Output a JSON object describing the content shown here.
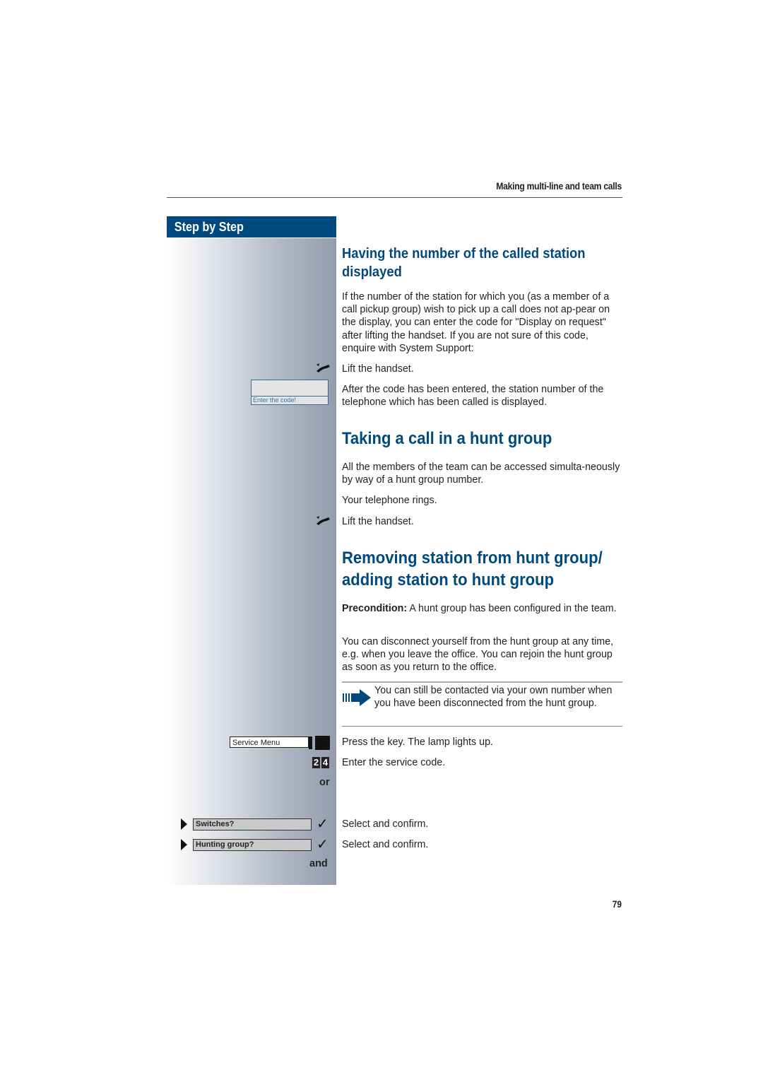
{
  "header": {
    "title": "Making multi-line and team calls"
  },
  "sidebar": {
    "heading": "Step by Step",
    "display": {
      "label": "Enter the code!"
    },
    "service_menu": {
      "label": "Service Menu"
    },
    "digits": [
      "2",
      "4"
    ],
    "or_label": "or",
    "menu_items": [
      {
        "label": "Switches?"
      },
      {
        "label": "Hunting group?"
      }
    ],
    "and_label": "and",
    "icons": {
      "handset": "handset-lift-icon",
      "check": "checkmark-icon",
      "arrow": "right-triangle-icon"
    }
  },
  "sections": {
    "display_number": {
      "title": "Having the number of the called station displayed",
      "intro": "If the number of the station for which you (as a member of a call pickup group) wish to pick up a call does not ap-pear on the display, you can enter the code for \"Display on request\" after lifting the handset. If you are not sure of this code, enquire with System Support:",
      "step1": "Lift the handset.",
      "step2": "After the code has been entered, the station number of the telephone which has been called is displayed."
    },
    "hunt_group_call": {
      "title": "Taking a call in a hunt group",
      "intro": "All the members of the team can be accessed simulta-neously by way of a hunt group number.",
      "step1": "Your telephone rings.",
      "step2": "Lift the handset."
    },
    "remove_add": {
      "title_line1": "Removing station from hunt group/",
      "title_line2": "adding station to hunt group",
      "precondition_label": "Precondition:",
      "precondition_text": " A hunt group has been configured in the team.",
      "body": "You can disconnect yourself from the hunt group at any time, e.g. when you leave the office. You can rejoin the hunt group as soon as you return to the office.",
      "note": "You can still be contacted via your own number when you have been disconnected from the hunt group.",
      "step_press": "Press the key. The lamp lights up.",
      "step_code": "Enter the service code.",
      "step_select1": "Select and confirm.",
      "step_select2": "Select and confirm."
    }
  },
  "footer": {
    "page_number": "79"
  },
  "colors": {
    "accent": "#00497e",
    "display_text": "#2a79a8"
  }
}
